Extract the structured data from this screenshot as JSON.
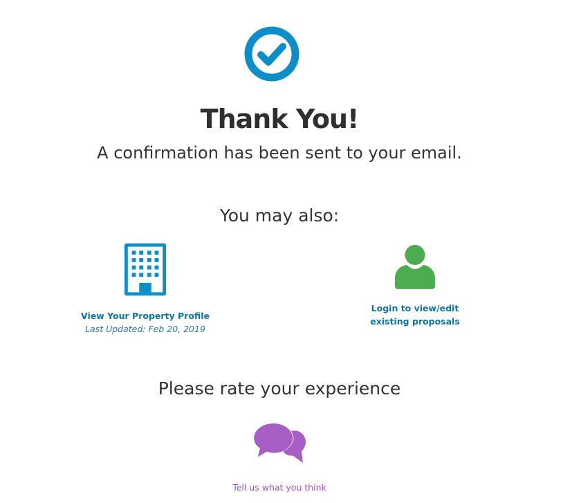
{
  "header": {
    "icon": "check-circle-icon",
    "title": "Thank You!",
    "subtitle": "A confirmation has been sent to your email."
  },
  "also": {
    "heading": "You may also:",
    "options": [
      {
        "icon": "building-icon",
        "label": "View Your Property Profile",
        "sub": "Last Updated: Feb 20, 2019",
        "color": "#0d8ec9"
      },
      {
        "icon": "user-icon",
        "label": "Login to view/edit existing proposals",
        "color": "#4cac4f"
      }
    ]
  },
  "rate": {
    "heading": "Please rate your experience",
    "icon": "chat-bubbles-icon",
    "link": "Tell us what you think",
    "color": "#a75fc5"
  },
  "colors": {
    "accent_blue": "#0d8ec9",
    "link_blue": "#0e74a8",
    "green": "#4cac4f",
    "purple": "#a75fc5"
  }
}
